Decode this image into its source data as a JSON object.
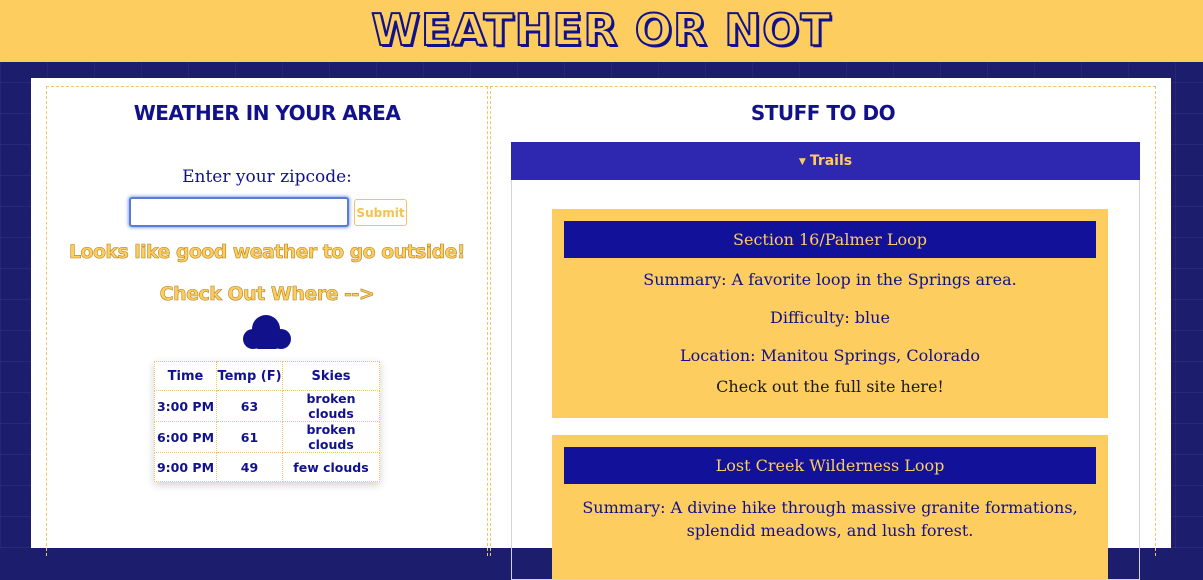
{
  "header": {
    "title": "WEATHER OR NOT"
  },
  "left": {
    "title": "WEATHER IN YOUR AREA",
    "zip_label": "Enter your zipcode:",
    "zip_value": "",
    "zip_placeholder": "",
    "submit_label": "Submit",
    "message": "Looks like good weather to go outside!",
    "cta": "Check Out Where -->",
    "weather_icon": "cloud-icon",
    "table": {
      "headers": [
        "Time",
        "Temp (F)",
        "Skies"
      ],
      "rows": [
        [
          "3:00 PM",
          "63",
          "broken clouds"
        ],
        [
          "6:00 PM",
          "61",
          "broken clouds"
        ],
        [
          "9:00 PM",
          "49",
          "few clouds"
        ]
      ]
    }
  },
  "right": {
    "title": "STUFF TO DO",
    "accordion_label": "Trails",
    "trails": [
      {
        "name": "Section 16/Palmer Loop",
        "summary": "Summary: A favorite loop in the Springs area.",
        "difficulty": "Difficulty: blue",
        "location": "Location: Manitou Springs, Colorado",
        "link": "Check out the full site here!"
      },
      {
        "name": "Lost Creek Wilderness Loop",
        "summary": "Summary: A divine hike through massive granite formations, splendid meadows, and lush forest."
      }
    ]
  },
  "colors": {
    "banner": "#fdcd5f",
    "navy": "#11118c",
    "accordion": "#2e27b0",
    "gold": "#fdcd5f"
  }
}
